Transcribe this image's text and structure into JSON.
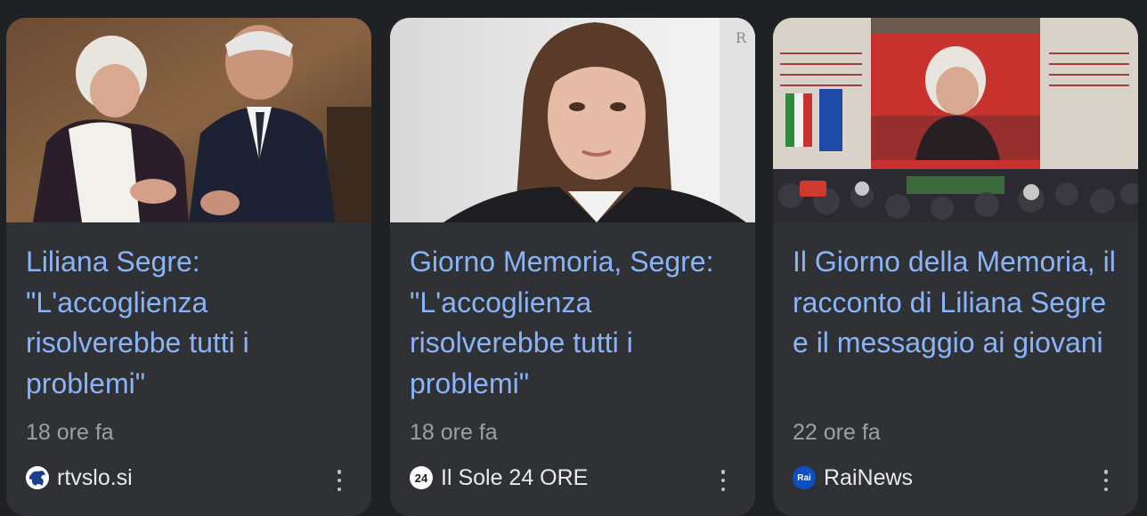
{
  "cards": [
    {
      "title": "Liliana Segre: \"L'accoglienza risolverebbe tutti i problemi\"",
      "time": "18 ore fa",
      "source": "rtvslo.si",
      "logo_icon": "rtvslo-logo-icon"
    },
    {
      "title": "Giorno Memoria, Segre: \"L'accoglienza risolverebbe tutti i problemi\"",
      "time": "18 ore fa",
      "source": "Il Sole 24 ORE",
      "logo_icon": "sole24ore-logo-icon",
      "logo_text": "24"
    },
    {
      "title": "Il Giorno della Memoria, il racconto di Liliana Segre e il messaggio ai giovani",
      "time": "22 ore fa",
      "source": "RaiNews",
      "logo_icon": "rainews-logo-icon",
      "logo_text": "Rai"
    }
  ],
  "colors": {
    "page_bg": "#202124",
    "card_bg": "#303134",
    "title": "#8ab4f8",
    "meta": "#9aa0a6",
    "source": "#e8eaed"
  }
}
